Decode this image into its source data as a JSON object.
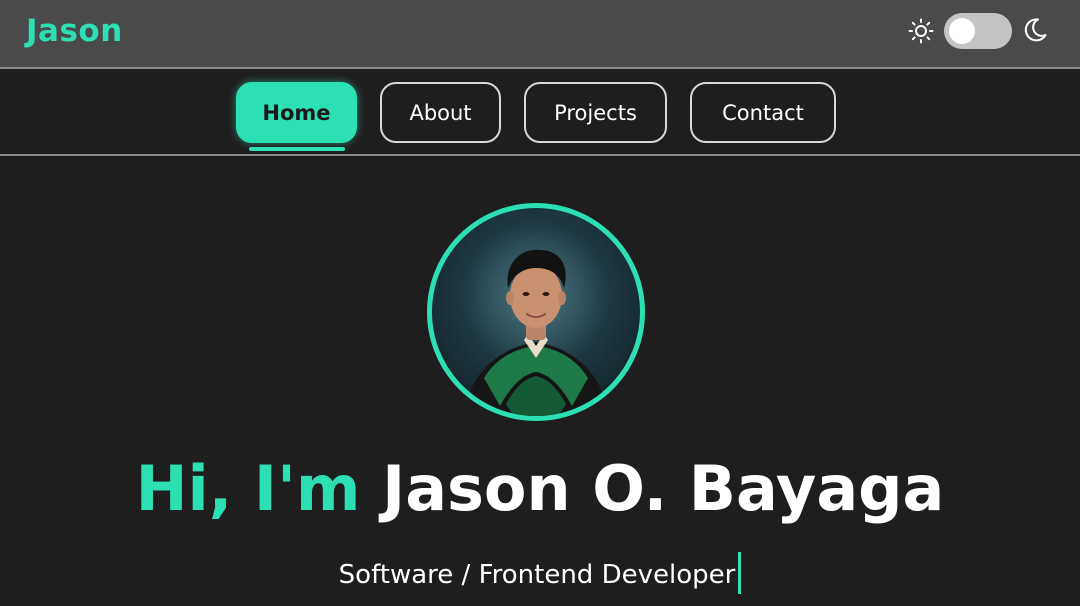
{
  "header": {
    "logo": "Jason",
    "theme_toggle": {
      "state": "light",
      "left_icon": "sun-icon",
      "right_icon": "moon-icon"
    }
  },
  "nav": {
    "items": [
      {
        "label": "Home",
        "active": true
      },
      {
        "label": "About",
        "active": false
      },
      {
        "label": "Projects",
        "active": false
      },
      {
        "label": "Contact",
        "active": false
      }
    ]
  },
  "hero": {
    "greeting": "Hi, I'm",
    "name": "Jason O. Bayaga",
    "subtitle": "Software / Frontend Developer"
  },
  "colors": {
    "accent": "#2de0b3",
    "background": "#1e1e1e",
    "topbar": "#4a4a4a"
  }
}
